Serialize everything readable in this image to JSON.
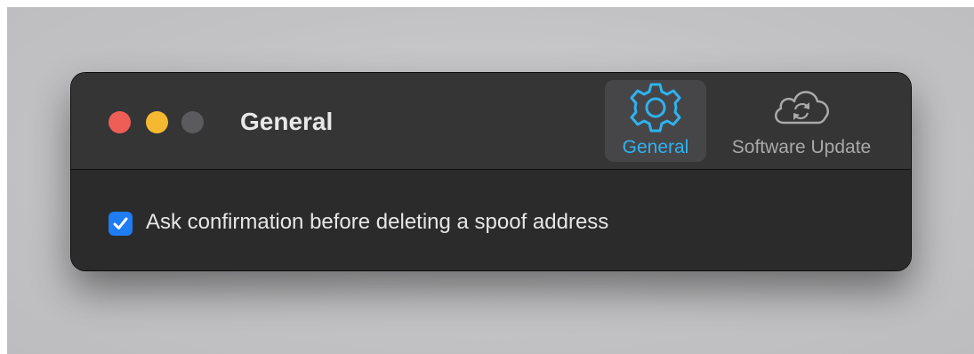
{
  "window": {
    "title": "General",
    "traffic_lights": {
      "close_color": "#ee5e57",
      "minimize_color": "#f5b931",
      "zoom_color": "#5b5b5e"
    }
  },
  "toolbar": {
    "tabs": [
      {
        "label": "General",
        "icon": "gear-icon",
        "selected": true,
        "color": "#2fb3f0"
      },
      {
        "label": "Software Update",
        "icon": "cloud-sync-icon",
        "selected": false,
        "color": "#a9a9a9"
      }
    ]
  },
  "settings": {
    "confirm_delete": {
      "label": "Ask confirmation before deleting a spoof address",
      "checked": true,
      "checkbox_color": "#1f7cf2"
    }
  }
}
